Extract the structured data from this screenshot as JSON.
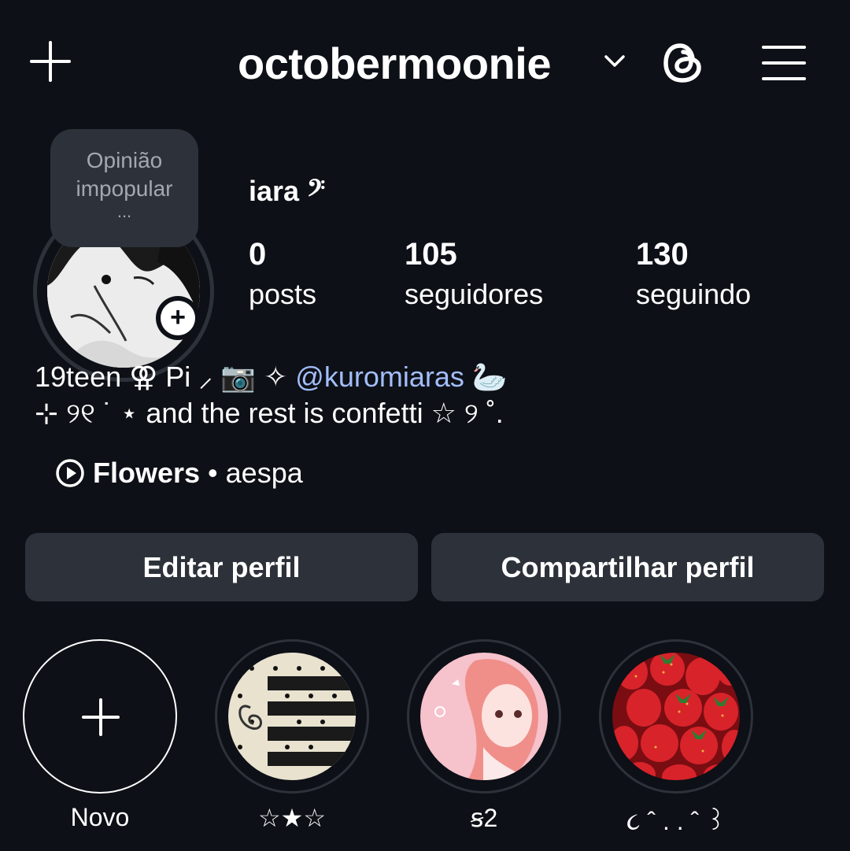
{
  "header": {
    "username": "octobermoonie",
    "icons": [
      "plus-icon",
      "chevron-down-icon",
      "threads-icon",
      "hamburger-menu-icon"
    ]
  },
  "profile": {
    "note_line1": "Opinião",
    "note_line2": "impopular",
    "note_dots": "...",
    "display_name": "iara 𝄢",
    "stats": [
      {
        "value": "0",
        "label": "posts"
      },
      {
        "value": "105",
        "label": "seguidores"
      },
      {
        "value": "130",
        "label": "seguindo"
      }
    ]
  },
  "bio": {
    "line1_prefix": "19teen ⚢ Pi ⸝ 📷 ✧ ",
    "mention": "@kuromiaras",
    "line1_suffix": " 🦢",
    "line2": "⊹ ୨୧ ˙ ⋆ and the rest is confetti ☆ ୨ ˚."
  },
  "music": {
    "song": "Flowers",
    "separator": "•",
    "artist": "aespa"
  },
  "buttons": {
    "edit": "Editar perfil",
    "share": "Compartilhar perfil"
  },
  "highlights": [
    {
      "label": "Novo"
    },
    {
      "label": "☆★☆"
    },
    {
      "label": "ꞩ2"
    },
    {
      "label": "૮ ˆ . . ˆ ꒱"
    }
  ],
  "colors": {
    "background": "#0d1016",
    "surface": "#2d323a",
    "mention": "#a3bdfa"
  }
}
